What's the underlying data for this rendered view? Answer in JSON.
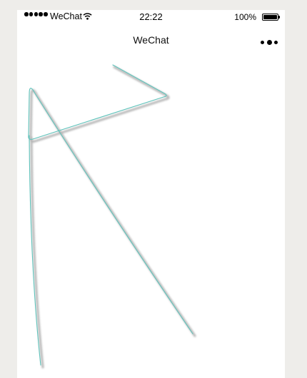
{
  "status_bar": {
    "carrier": "WeChat",
    "time": "22:22",
    "battery_percent": "100%",
    "battery_level": 1.0,
    "signal_bars": 5
  },
  "nav": {
    "title": "WeChat",
    "more_icon": "more-dots-icon"
  },
  "drawing": {
    "stroke_color": "#5fc3bb",
    "shadow_color": "#9a9a9a"
  }
}
